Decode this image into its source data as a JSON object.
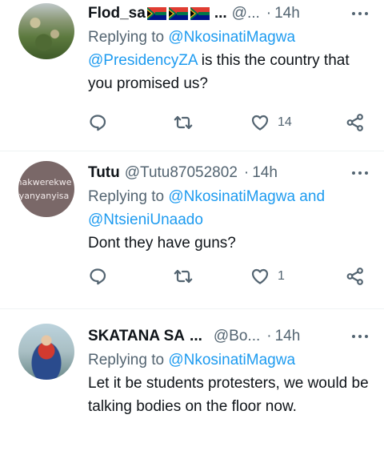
{
  "tweets": [
    {
      "name": "Flod_sa",
      "name_suffix": "...",
      "handle": "@...",
      "time": "14h",
      "replying_label": "Replying to ",
      "replying_to": [
        "@NkosinatiMagwa"
      ],
      "body_mention": "@PresidencyZA",
      "body": " is this the country that you promised us?",
      "reply_count": "",
      "retweet_count": "",
      "like_count": "14",
      "avatar": "landscape-photo"
    },
    {
      "name": "Tutu",
      "handle": "@Tutu87052802",
      "time": "14h",
      "replying_label": "Replying to ",
      "replying_to": [
        "@NkosinatiMagwa",
        "@NtsieniUnaado"
      ],
      "replying_joiner": " and ",
      "body": "Dont they have guns?",
      "like_count": "1",
      "avatar_text_line1": "hakwerekwe",
      "avatar_text_line2": "yanyanyisa"
    },
    {
      "name": "SKATANA SA",
      "name_suffix": "...",
      "handle": "@Bo...",
      "time": "14h",
      "replying_label": "Replying to ",
      "replying_to": [
        "@NkosinatiMagwa"
      ],
      "body": "Let it be students protesters, we would be talking bodies on the floor now.",
      "avatar": "jetski-photo"
    }
  ],
  "separator": "·",
  "colors": {
    "link": "#1d9bf0",
    "secondary": "#536471",
    "text": "#0f1419"
  },
  "icons": [
    "reply-icon",
    "retweet-icon",
    "like-icon",
    "share-icon",
    "more-icon",
    "south-africa-flag-icon"
  ]
}
